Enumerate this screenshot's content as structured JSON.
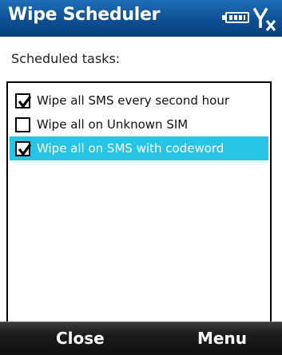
{
  "window": {
    "title": "Wipe Scheduler",
    "status_icons": [
      "battery-icon",
      "signal-icon"
    ]
  },
  "settings": {
    "section_label": "Scheduled tasks:",
    "tasks": [
      {
        "label": "Wipe all SMS every second hour",
        "checked": true,
        "selected": false
      },
      {
        "label": "Wipe all on Unknown SIM",
        "checked": false,
        "selected": false
      },
      {
        "label": "Wipe all on SMS with codeword",
        "checked": true,
        "selected": true
      }
    ]
  },
  "softkeys": {
    "left_label": "Close",
    "right_label": "Menu"
  },
  "colors": {
    "titlebar": "#0d4f93",
    "selection": "#28c4e6",
    "softkey_bar": "#111111"
  }
}
